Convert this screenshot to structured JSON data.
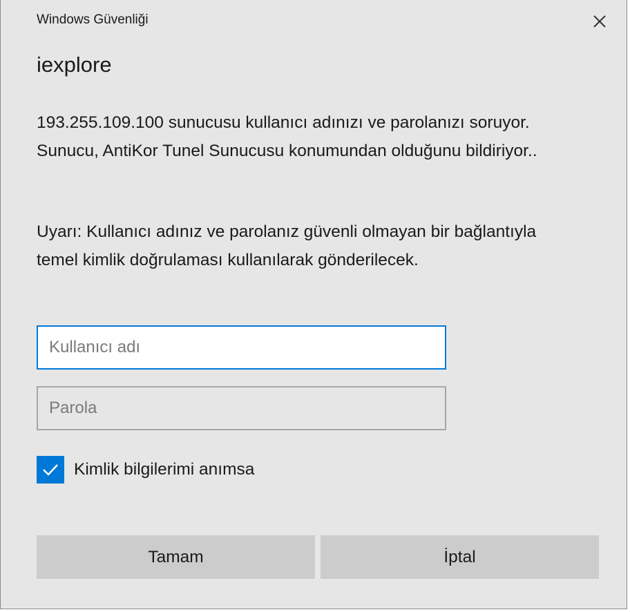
{
  "window": {
    "title": "Windows Güvenliği",
    "close_icon": "close-icon"
  },
  "app_name": "iexplore",
  "message": {
    "server_text": "193.255.109.100 sunucusu kullanıcı adınızı ve parolanızı soruyor. Sunucu, AntiKor Tunel Sunucusu konumundan olduğunu bildiriyor..",
    "warning_text": "Uyarı: Kullanıcı adınız ve parolanız güvenli olmayan bir bağlantıyla temel kimlik doğrulaması kullanılarak gönderilecek."
  },
  "form": {
    "username_value": "",
    "username_placeholder": "Kullanıcı adı",
    "password_value": "",
    "password_placeholder": "Parola",
    "remember_label": "Kimlik bilgilerimi anımsa",
    "remember_checked": true
  },
  "buttons": {
    "ok_label": "Tamam",
    "cancel_label": "İptal"
  },
  "colors": {
    "accent": "#0078d7",
    "dialog_bg": "#e6e6e6",
    "button_bg": "#cccccc"
  }
}
